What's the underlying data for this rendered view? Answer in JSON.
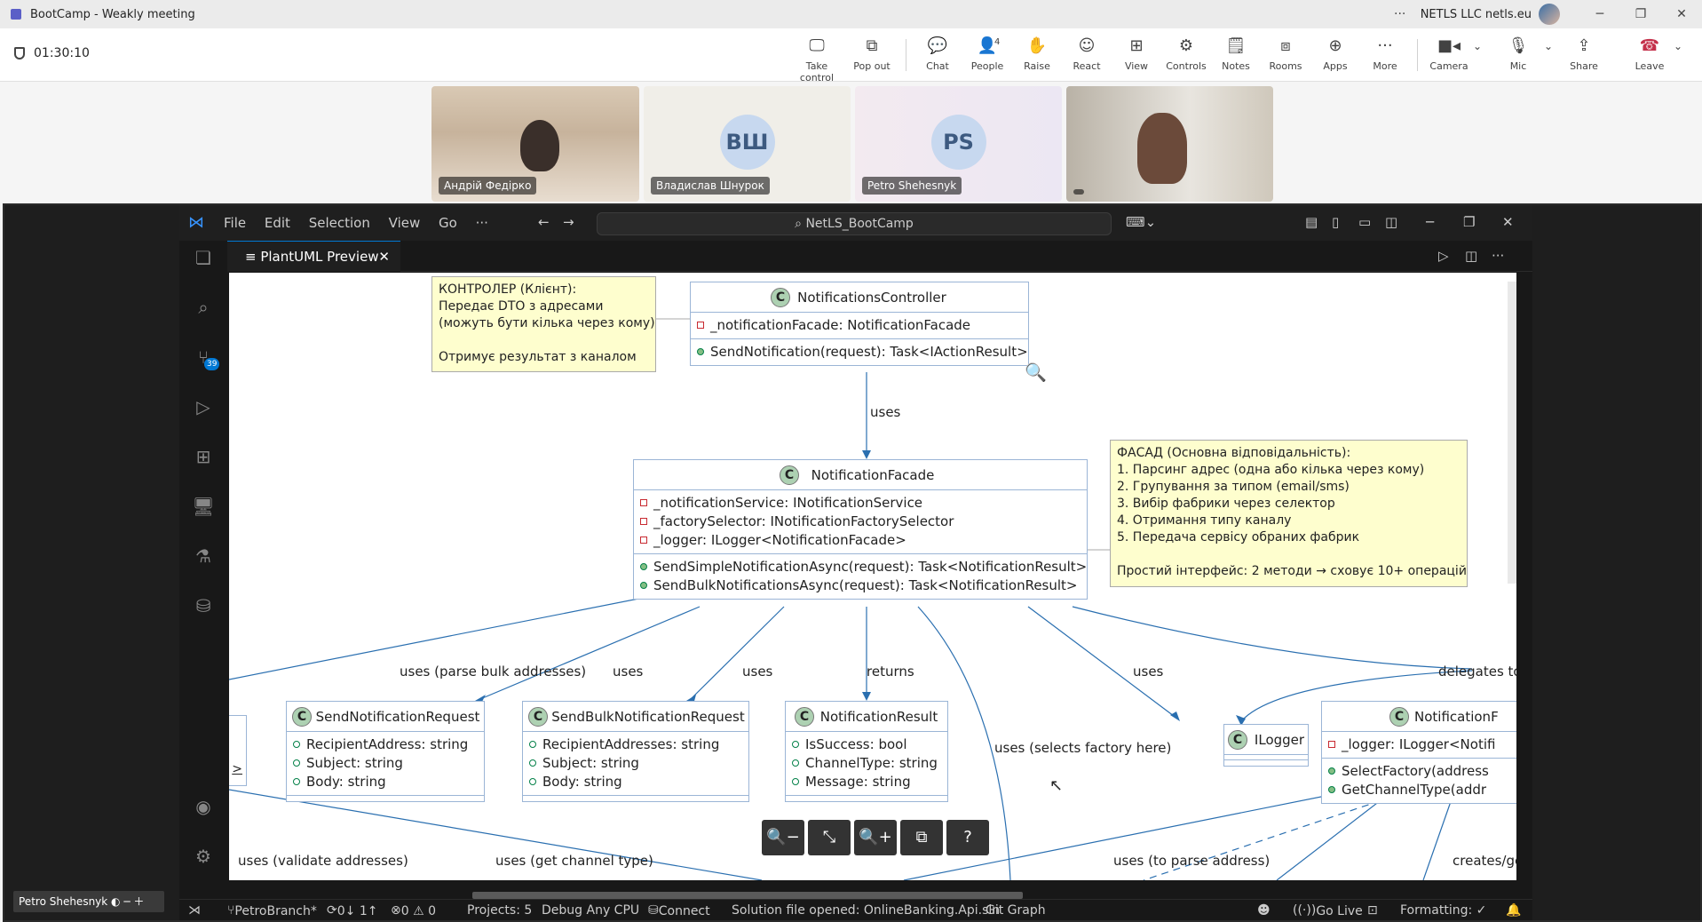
{
  "teams": {
    "window_title": "BootCamp - Weakly meeting",
    "org": "NETLS LLC netls.eu",
    "more": "···",
    "timer": "01:30:10",
    "toolbar": [
      {
        "label": "Take control",
        "icon": "take-control-icon"
      },
      {
        "label": "Pop out",
        "icon": "pop-out-icon"
      },
      {
        "label": "Chat",
        "icon": "chat-icon"
      },
      {
        "label": "People",
        "icon": "people-icon",
        "badge": "4"
      },
      {
        "label": "Raise",
        "icon": "hand-icon"
      },
      {
        "label": "React",
        "icon": "smile-icon"
      },
      {
        "label": "View",
        "icon": "grid-icon"
      },
      {
        "label": "Controls",
        "icon": "shield-gear-icon"
      },
      {
        "label": "Notes",
        "icon": "notes-icon"
      },
      {
        "label": "Rooms",
        "icon": "rooms-icon"
      },
      {
        "label": "Apps",
        "icon": "plus-icon"
      },
      {
        "label": "More",
        "icon": "more-icon"
      },
      {
        "label": "Camera",
        "icon": "camera-icon"
      },
      {
        "label": "Mic",
        "icon": "mic-icon"
      },
      {
        "label": "Share",
        "icon": "share-icon"
      },
      {
        "label": "Leave",
        "icon": "phone-hangup-icon"
      }
    ],
    "participants": [
      {
        "name": "Андрій Федірко",
        "type": "video"
      },
      {
        "name": "Владислав Шнурок",
        "initials": "ВШ",
        "type": "avatar"
      },
      {
        "name": "Petro Shehesnyk",
        "initials": "PS",
        "type": "avatar"
      },
      {
        "name": "",
        "type": "video"
      }
    ],
    "pip_name": "Petro Shehesnyk"
  },
  "vscode": {
    "menu": [
      "File",
      "Edit",
      "Selection",
      "View",
      "Go",
      "···"
    ],
    "search": "NetLS_BootCamp",
    "tab": "PlantUML Preview",
    "scm_badge": "39",
    "status": {
      "branch": "PetroBranch*",
      "sync": "0↓ 1↑",
      "problems": "0 ⚠ 0",
      "projects": "Projects: 5",
      "debug": "Debug Any CPU",
      "connect": "Connect",
      "solution": "Solution file opened: OnlineBanking.Api.sln",
      "git_graph": "Git Graph",
      "go_live": "Go Live",
      "formatting": "Formatting: ✓"
    }
  },
  "diagram": {
    "controller": {
      "name": "NotificationsController",
      "fields": [
        "_notificationFacade: NotificationFacade"
      ],
      "methods": [
        "SendNotification(request): Task<IActionResult>"
      ]
    },
    "facade": {
      "name": "NotificationFacade",
      "fields": [
        "_notificationService: INotificationService",
        "_factorySelector: INotificationFactorySelector",
        "_logger: ILogger<NotificationFacade>"
      ],
      "methods": [
        "SendSimpleNotificationAsync(request): Task<NotificationResult>",
        "SendBulkNotificationsAsync(request): Task<NotificationResult>"
      ]
    },
    "send_req": {
      "name": "SendNotificationRequest",
      "fields": [
        "RecipientAddress: string",
        "Subject: string",
        "Body: string"
      ]
    },
    "bulk_req": {
      "name": "SendBulkNotificationRequest",
      "fields": [
        "RecipientAddresses: string",
        "Subject: string",
        "Body: string"
      ]
    },
    "result": {
      "name": "NotificationResult",
      "fields": [
        "IsSuccess: bool",
        "ChannelType: string",
        "Message: string"
      ]
    },
    "ilogger": {
      "name": "ILogger"
    },
    "selector": {
      "name": "NotificationF",
      "fields": [
        "_logger: ILogger<Notifi"
      ],
      "methods": [
        "SelectFactory(address",
        "GetChannelType(addr"
      ]
    },
    "partial_left": ">",
    "note_controller": "КОНТРОЛЕР (Клієнт):\nПередає DTO з адресами\n(можуть бути кілька через кому)\n\nОтримує результат з каналом",
    "note_facade": "ФАСАД (Основна відповідальність):\n1. Парсинг адрес (одна або кілька через кому)\n2. Групування за типом (email/sms)\n3. Вибір фабрики через селектор\n4. Отримання типу каналу\n5. Передача сервісу обраних фабрик\n\nПростий інтерфейс: 2 методи → сховує 10+ операцій",
    "labels": {
      "uses_top": "uses",
      "parse_bulk": "uses (parse bulk addresses)",
      "uses_a": "uses",
      "uses_b": "uses",
      "returns": "returns",
      "uses_c": "uses",
      "delegates": "delegates to",
      "selects": "uses (selects factory here)",
      "validate": "uses (validate addresses)",
      "channel": "uses (get channel type)",
      "parse_addr": "uses (to parse address)",
      "creates": "creates/ge"
    },
    "zoom_buttons": [
      "🔍−",
      "⤡",
      "🔍+",
      "⧉",
      "?"
    ]
  }
}
